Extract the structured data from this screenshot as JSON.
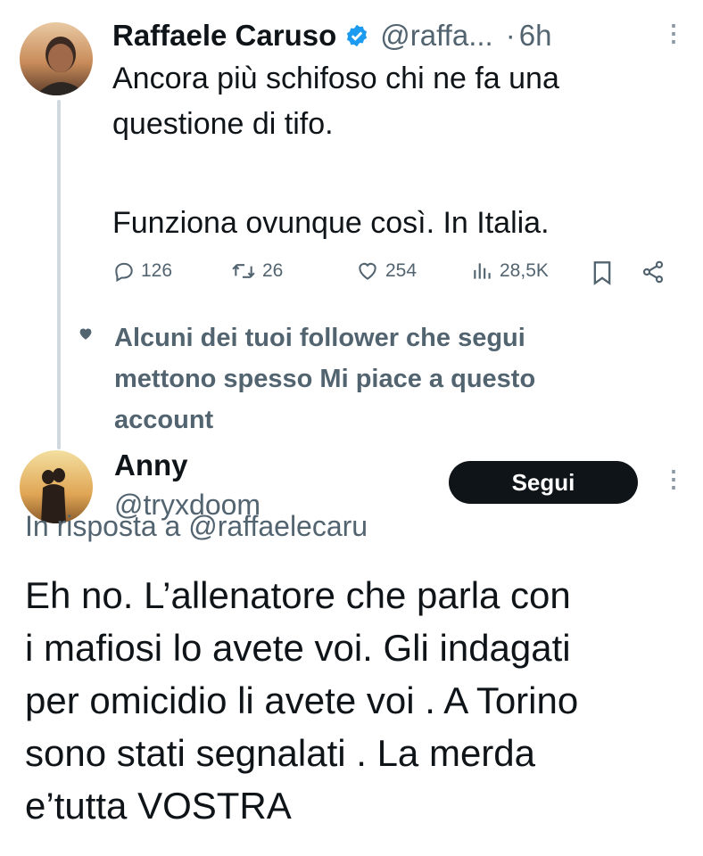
{
  "tweet": {
    "author_name": "Raffaele Caruso",
    "handle": "@raffa...",
    "separator": "·",
    "time": "6h",
    "text_line1": "Ancora più schifoso chi ne fa una",
    "text_line2": "questione di tifo.",
    "text_line3": "Funziona ovunque così. In Italia.",
    "metrics": {
      "replies": "126",
      "retweets": "26",
      "likes": "254",
      "views": "28,5K"
    }
  },
  "social_context": {
    "line1": "Alcuni dei tuoi follower che segui",
    "line2": "mettono spesso Mi piace a questo",
    "line3": "account"
  },
  "reply": {
    "author_name": "Anny",
    "handle": "@tryxdoom",
    "reply_to": "In risposta a @raffaelecaru",
    "follow_label": "Segui",
    "lines": [
      "Eh no. L’allenatore che parla con",
      "i mafiosi lo avete voi. Gli indagati",
      "per omicidio li avete voi . A Torino",
      "sono stati segnalati . La merda",
      "e’tutta VOSTRA"
    ]
  },
  "colors": {
    "text": "#0f1419",
    "secondary": "#536471",
    "verified": "#1d9bf0",
    "thread_line": "#cfd9de",
    "button_bg": "#0f1419"
  }
}
